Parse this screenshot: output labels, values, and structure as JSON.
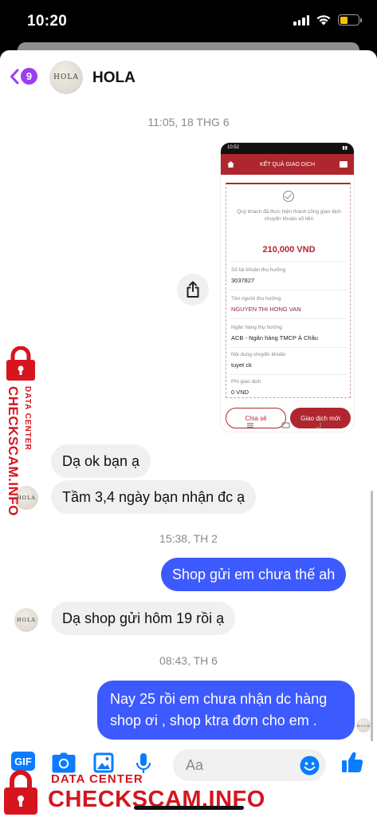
{
  "status_bar": {
    "time": "10:20"
  },
  "header": {
    "back_count": "9",
    "avatar_text": "HOLA",
    "name": "HOLA"
  },
  "timestamps": [
    "11:05, 18 THG 6",
    "15:38, TH 2",
    "08:43, TH 6"
  ],
  "receipt": {
    "status_time": "10:52",
    "title": "KẾT QUẢ GIAO DỊCH",
    "message": "Quý khách đã thực hiện thành công giao dịch chuyển khoản số tiền",
    "amount": "210,000 VND",
    "fields": [
      {
        "label": "Số tài khoản thụ hưởng",
        "value": "3037827"
      },
      {
        "label": "Tên người thụ hưởng",
        "value": "NGUYEN THI HONG VAN"
      },
      {
        "label": "Ngân hàng thụ hưởng",
        "value": "ACB - Ngân hàng TMCP Á Châu"
      },
      {
        "label": "Nội dung chuyển khoản",
        "value": "tuyet ck"
      },
      {
        "label": "Phí giao dịch",
        "value": "0 VND"
      }
    ],
    "share_label": "Chia sẻ",
    "new_label": "Giao dịch mới"
  },
  "messages": [
    {
      "from": "them",
      "text": "Dạ ok bạn ạ"
    },
    {
      "from": "them",
      "text": "Tầm 3,4 ngày bạn nhận đc ạ"
    },
    {
      "from": "me",
      "text": "Shop gửi em chưa thế ah"
    },
    {
      "from": "them",
      "text": "Dạ shop gửi hôm 19 rồi ạ"
    },
    {
      "from": "me",
      "text": "Nay 25 rồi em chưa nhận dc hàng shop ơi , shop ktra đơn cho em ."
    }
  ],
  "composer": {
    "placeholder": "Aa",
    "gif_label": "GIF"
  },
  "watermark": {
    "top": "DATA CENTER",
    "main": "CHECKSCAM.INFO"
  },
  "colors": {
    "outgoing": "#3d5afe",
    "incoming": "#f0f0f0",
    "accent": "#0a7cff",
    "watermark": "#d6151f"
  }
}
